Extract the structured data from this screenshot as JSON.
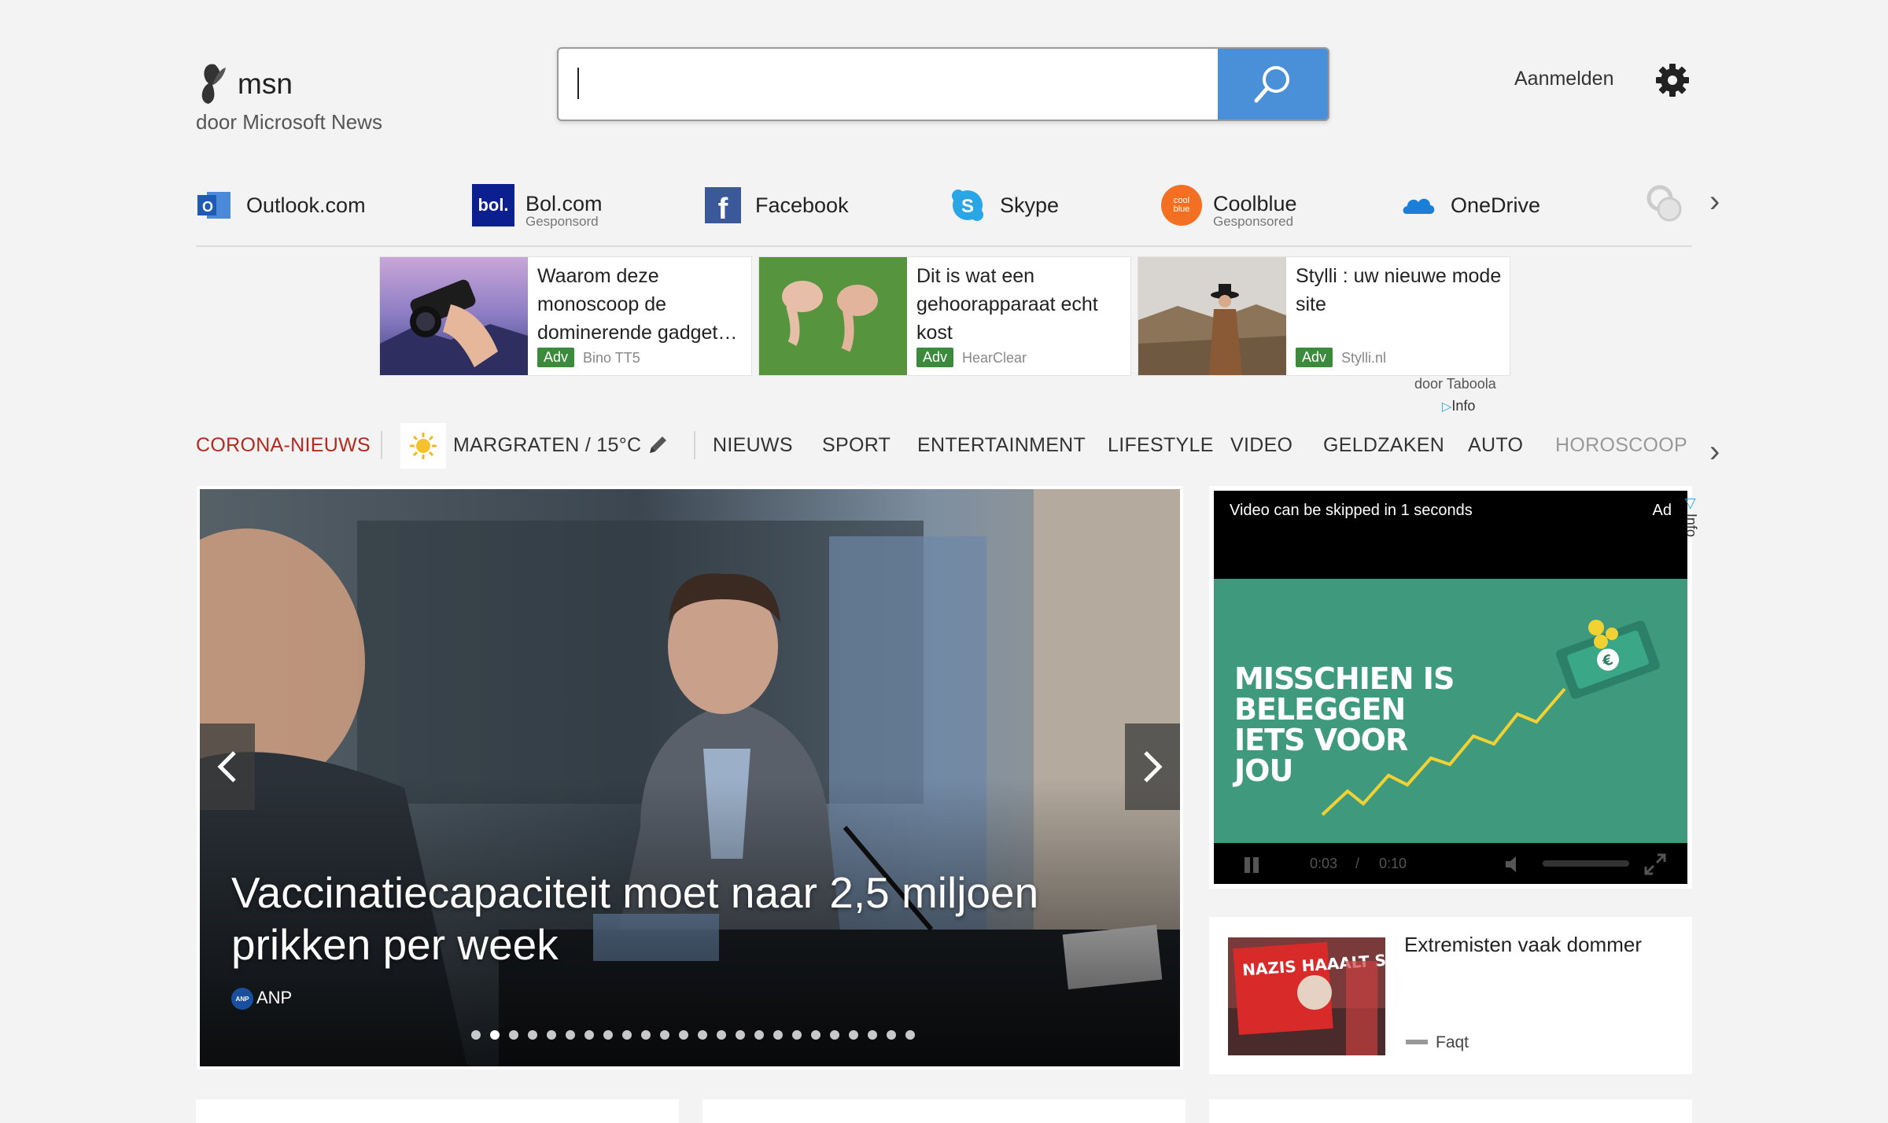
{
  "header": {
    "logo_text": "msn",
    "logo_sub": "door Microsoft News",
    "search_placeholder": "",
    "signin": "Aanmelden"
  },
  "quicklinks": [
    {
      "label": "Outlook.com",
      "sub": "",
      "icon": "outlook-icon"
    },
    {
      "label": "Bol.com",
      "sub": "Gesponsord",
      "icon": "bol-icon"
    },
    {
      "label": "Facebook",
      "sub": "",
      "icon": "facebook-icon"
    },
    {
      "label": "Skype",
      "sub": "",
      "icon": "skype-icon"
    },
    {
      "label": "Coolblue",
      "sub": "Gesponsored",
      "icon": "coolblue-icon"
    },
    {
      "label": "OneDrive",
      "sub": "",
      "icon": "onedrive-icon"
    }
  ],
  "ads": [
    {
      "title": "Waarom deze monoscoop de dominerende gadget…",
      "adv": "Adv",
      "source": "Bino TT5"
    },
    {
      "title": "Dit is wat een gehoorapparaat echt kost",
      "adv": "Adv",
      "source": "HearClear"
    },
    {
      "title": "Stylli : uw nieuwe mode site",
      "adv": "Adv",
      "source": "Stylli.nl"
    }
  ],
  "taboola": {
    "by": "door Taboola",
    "info": "Info"
  },
  "nav": {
    "corona": "CORONA-NIEUWS",
    "weather": "MARGRATEN / 15°C",
    "items": [
      "NIEUWS",
      "SPORT",
      "ENTERTAINMENT",
      "LIFESTYLE",
      "VIDEO",
      "GELDZAKEN",
      "AUTO",
      "HOROSCOOP"
    ]
  },
  "hero": {
    "title": "Vaccinatiecapaciteit moet naar 2,5 miljoen prikken per week",
    "source": "ANP",
    "source_logo": "ANP",
    "slide_count": 24,
    "active_slide": 2
  },
  "video_ad": {
    "skip_text": "Video can be skipped in 1 seconds",
    "ad_label": "Ad",
    "headline": "MISSCHIEN IS BELEGGEN IETS VOOR JOU",
    "time_current": "0:03",
    "time_sep": "/",
    "time_total": "0:10",
    "info": "Info"
  },
  "side_story": {
    "title": "Extremisten vaak dommer",
    "source": "Faqt",
    "image_text": "NAZIS HAAALT STOP!"
  },
  "colors": {
    "accent": "#4a90d9",
    "corona": "#b52a1f",
    "adv_badge": "#3c8a3c",
    "video_green": "#3f9a7d"
  }
}
